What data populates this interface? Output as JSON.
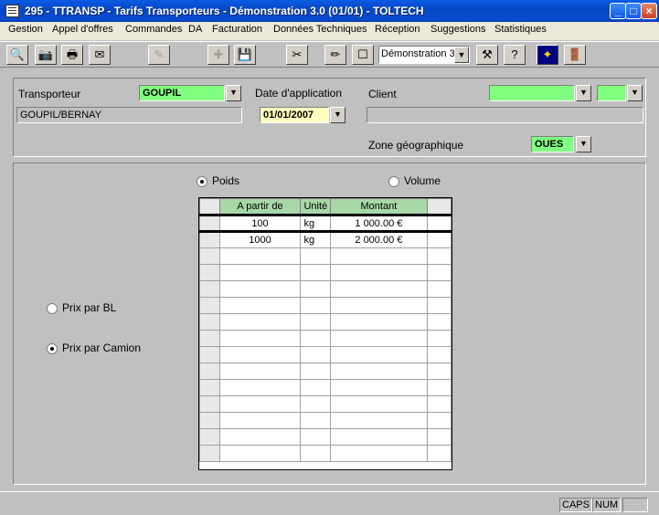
{
  "window": {
    "title": "295 - TTRANSP - Tarifs Transporteurs - Démonstration 3.0 (01/01) - TOLTECH"
  },
  "menu": [
    "Gestion",
    "Appel d'offres",
    "Commandes",
    "DA",
    "Facturation",
    "Données Techniques",
    "Réception",
    "Suggestions",
    "Statistiques"
  ],
  "toolbar": {
    "combo_value": "Démonstration 3"
  },
  "header": {
    "transporteur_label": "Transporteur",
    "transporteur_code": "GOUPIL",
    "transporteur_name": "GOUPIL/BERNAY",
    "date_label": "Date d'application",
    "date_value": "01/01/2007",
    "client_label": "Client",
    "client_code": "",
    "client_sub": "",
    "client_name": "",
    "zone_label": "Zone géographique",
    "zone_value": "OUES"
  },
  "options": {
    "poids_label": "Poids",
    "volume_label": "Volume",
    "selected_basis": "Poids",
    "prix_bl_label": "Prix par BL",
    "prix_camion_label": "Prix par Camion",
    "selected_price": "Prix par Camion"
  },
  "grid": {
    "columns": [
      "A partir de",
      "Unité",
      "Montant"
    ],
    "rows": [
      [
        "100",
        "kg",
        "1 000.00 €"
      ],
      [
        "1000",
        "kg",
        "2 000.00 €"
      ]
    ]
  },
  "status": {
    "caps": "CAPS",
    "num": "NUM"
  },
  "colors": {
    "title": "#0847c4",
    "field_green": "#80ff80",
    "field_yellow": "#ffffc0",
    "grid_header": "#a8d8a8"
  }
}
